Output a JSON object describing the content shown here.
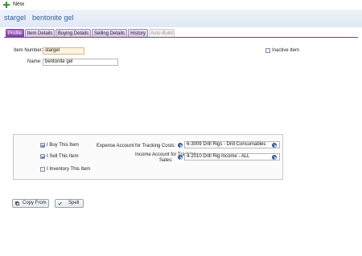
{
  "window": {
    "title": "New"
  },
  "header": {
    "item_code": "stargel",
    "item_name": "bentonite gel"
  },
  "tabs": [
    {
      "label": "Profile",
      "state": "active"
    },
    {
      "label": "Item Details",
      "state": "normal"
    },
    {
      "label": "Buying Details",
      "state": "normal"
    },
    {
      "label": "Selling Details",
      "state": "normal"
    },
    {
      "label": "History",
      "state": "normal"
    },
    {
      "label": "Auto-Build",
      "state": "disabled"
    }
  ],
  "form": {
    "item_number_label": "Item Number:",
    "item_number_value": "stargel",
    "name_label": "Name:",
    "name_value": "bentonite gel",
    "inactive_label": "Inactive Item",
    "inactive_checked": false
  },
  "options": {
    "buy_label": "I Buy This Item",
    "buy_checked": true,
    "sell_label": "I Sell This Item",
    "sell_checked": true,
    "inventory_label": "I Inventory This Item",
    "inventory_checked": false,
    "expense_label": "Expense Account for Tracking Costs:",
    "expense_value": "6-3009 Drill Rigs - Drill Consumables",
    "income_label_line1": "Income Account for Tracking",
    "income_label_line2": "Sales:",
    "income_value": "4-2010 Drill Rig Income - ALL"
  },
  "buttons": {
    "copy_from": "Copy From",
    "spell": "Spell"
  },
  "colors": {
    "tab_active": "#7c3d9e",
    "header_text": "#3a5f9a",
    "field_highlight": "#fff3e0"
  }
}
